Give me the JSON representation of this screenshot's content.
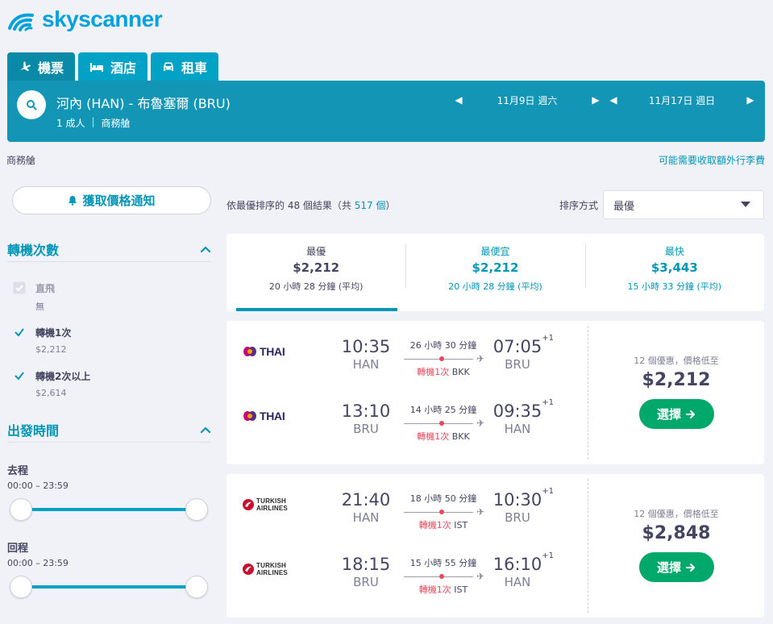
{
  "brand": {
    "name": "skyscanner",
    "color": "#00a1de"
  },
  "tabs": [
    {
      "label": "機票",
      "icon": "plane-icon",
      "active": true
    },
    {
      "label": "酒店",
      "icon": "bed-icon"
    },
    {
      "label": "租車",
      "icon": "car-icon"
    }
  ],
  "search": {
    "route": "河內 (HAN) - 布魯塞爾 (BRU)",
    "passengers": "1 成人",
    "cabin": "商務艙",
    "depart_date": "11月9日 週六",
    "return_date": "11月17日 週日"
  },
  "subheader": {
    "cabin_label": "商務艙",
    "baggage_notice": "可能需要收取額外行李費"
  },
  "sidebar": {
    "alert_button": "獲取價格通知",
    "stops": {
      "title": "轉機次數",
      "options": [
        {
          "label": "直飛",
          "sub": "無",
          "checked": true,
          "disabled": true
        },
        {
          "label": "轉機1次",
          "sub": "$2,212",
          "checked": true,
          "disabled": false
        },
        {
          "label": "轉機2次以上",
          "sub": "$2,614",
          "checked": true,
          "disabled": false
        }
      ]
    },
    "departure_times": {
      "title": "出發時間",
      "outbound": {
        "label": "去程",
        "range": "00:00 – 23:59"
      },
      "inbound": {
        "label": "回程",
        "range": "00:00 – 23:59"
      }
    }
  },
  "results": {
    "count_prefix": "依最優排序的 48 個結果（共",
    "total": "517 個",
    "count_suffix": "）",
    "sort_label": "排序方式",
    "sort_value": "最優"
  },
  "sort_tabs": [
    {
      "title": "最優",
      "price": "$2,212",
      "duration": "20 小時 28 分鐘 (平均)",
      "active": true
    },
    {
      "title": "最便宜",
      "price": "$2,212",
      "duration": "20 小時 28 分鐘 (平均)"
    },
    {
      "title": "最快",
      "price": "$3,443",
      "duration": "15 小時 33 分鐘 (平均)"
    }
  ],
  "itineraries": [
    {
      "airline": "THAI",
      "deals": "12 個優惠，價格低至",
      "price": "$2,212",
      "select_label": "選擇",
      "legs": [
        {
          "dep_time": "10:35",
          "dep_code": "HAN",
          "arr_time": "07:05",
          "arr_code": "BRU",
          "day_offset": "+1",
          "duration": "26 小時 30 分鐘",
          "stops": "轉機1次",
          "via": "BKK"
        },
        {
          "dep_time": "13:10",
          "dep_code": "BRU",
          "arr_time": "09:35",
          "arr_code": "HAN",
          "day_offset": "+1",
          "duration": "14 小時 25 分鐘",
          "stops": "轉機1次",
          "via": "BKK"
        }
      ]
    },
    {
      "airline_line1": "TURKISH",
      "airline_line2": "AIRLINES",
      "deals": "12 個優惠，價格低至",
      "price": "$2,848",
      "select_label": "選擇",
      "legs": [
        {
          "dep_time": "21:40",
          "dep_code": "HAN",
          "arr_time": "10:30",
          "arr_code": "BRU",
          "day_offset": "+1",
          "duration": "18 小時 50 分鐘",
          "stops": "轉機1次",
          "via": "IST"
        },
        {
          "dep_time": "18:15",
          "dep_code": "BRU",
          "arr_time": "16:10",
          "arr_code": "HAN",
          "day_offset": "+1",
          "duration": "15 小時 55 分鐘",
          "stops": "轉機1次",
          "via": "IST"
        }
      ]
    }
  ]
}
